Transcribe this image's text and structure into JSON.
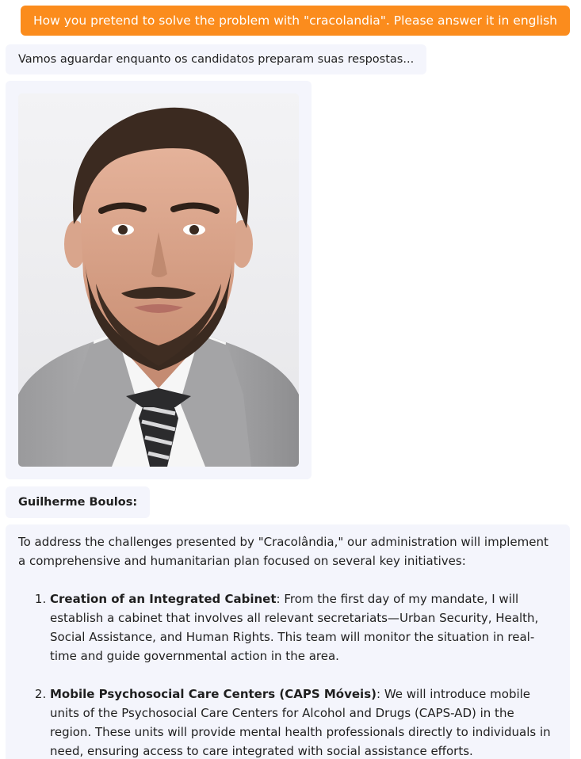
{
  "user_message": {
    "text": "How you pretend to solve the problem with \"cracolandia\". Please answer it in english",
    "color": "#fb8c1d"
  },
  "status_message": {
    "text": "Vamos aguardar enquanto os candidatos preparam suas respostas..."
  },
  "candidate": {
    "name": "Guilherme Boulos:",
    "photo_alt": "Portrait of Guilherme Boulos"
  },
  "answer": {
    "intro": "To address the challenges presented by \"Cracolândia,\" our administration will implement a comprehensive and humanitarian plan focused on several key initiatives:",
    "items": [
      {
        "title": "Creation of an Integrated Cabinet",
        "text": ": From the first day of my mandate, I will establish a cabinet that involves all relevant secretariats—Urban Security, Health, Social Assistance, and Human Rights. This team will monitor the situation in real-time and guide governmental action in the area."
      },
      {
        "title": "Mobile Psychosocial Care Centers (CAPS Móveis)",
        "text": ": We will introduce mobile units of the Psychosocial Care Centers for Alcohol and Drugs (CAPS-AD) in the region. These units will provide mental health professionals directly to individuals in need, ensuring access to care integrated with social assistance efforts."
      }
    ]
  },
  "colors": {
    "bot_bubble_bg": "#f4f5fc",
    "user_bubble_bg": "#fb8c1d",
    "text": "#1f1f1f"
  }
}
